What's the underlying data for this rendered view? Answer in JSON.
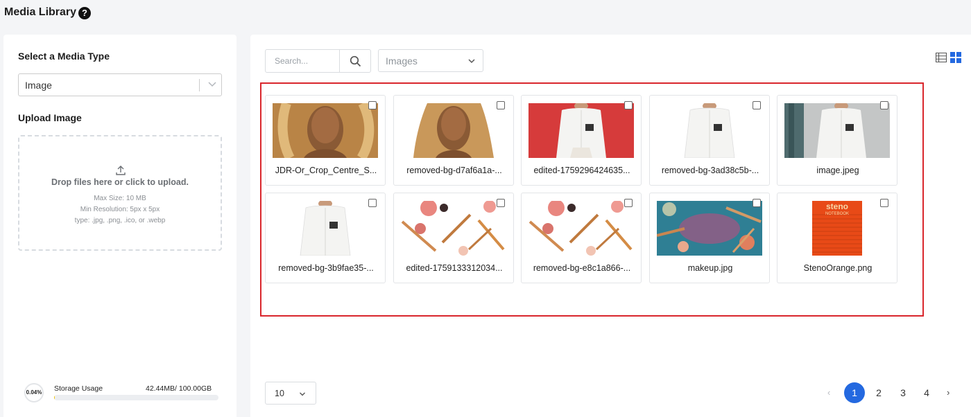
{
  "header": {
    "title": "Media Library",
    "help_icon": "question-circle-icon"
  },
  "left_panel": {
    "media_type_heading": "Select a Media Type",
    "media_type_value": "Image",
    "upload_heading": "Upload Image",
    "dropzone": {
      "icon": "upload-icon",
      "main_text": "Drop files here or click to upload.",
      "max_size": "Max Size: 10 MB",
      "min_resolution": "Min Resolution: 5px x 5px",
      "types": "type: .jpg, .png, .ico, or .webp"
    },
    "storage": {
      "percent_label": "0.04%",
      "label": "Storage Usage",
      "amount": "42.44MB/ 100.00GB",
      "used_fraction": 0.0004
    }
  },
  "toolbar": {
    "search_placeholder": "Search...",
    "filter_value": "Images"
  },
  "media_items": [
    {
      "name": "JDR-Or_Crop_Centre_S...",
      "thumb": "woman-portrait"
    },
    {
      "name": "removed-bg-d7af6a1a-...",
      "thumb": "woman-portrait-cutout"
    },
    {
      "name": "edited-1759296424635...",
      "thumb": "jacket-red-background"
    },
    {
      "name": "removed-bg-3ad38c5b-...",
      "thumb": "jacket-cutout"
    },
    {
      "name": "image.jpeg",
      "thumb": "jacket-gray-background"
    },
    {
      "name": "removed-bg-3b9fae35-...",
      "thumb": "jacket-cutout"
    },
    {
      "name": "edited-1759133312034...",
      "thumb": "makeup-white"
    },
    {
      "name": "removed-bg-e8c1a866-...",
      "thumb": "makeup-white"
    },
    {
      "name": "makeup.jpg",
      "thumb": "makeup-teal"
    },
    {
      "name": "StenoOrange.png",
      "thumb": "steno-notebook",
      "thumb_text": [
        "steno",
        "NOTEBOOK"
      ]
    }
  ],
  "pagination": {
    "per_page": "10",
    "prev": "‹",
    "next": "›",
    "pages": [
      "1",
      "2",
      "3",
      "4"
    ],
    "current": "1"
  },
  "colors": {
    "accent": "#2469e0",
    "highlight": "#d9262c",
    "thumb_red": "#d63b3b",
    "steno_orange": "#e84a17"
  }
}
